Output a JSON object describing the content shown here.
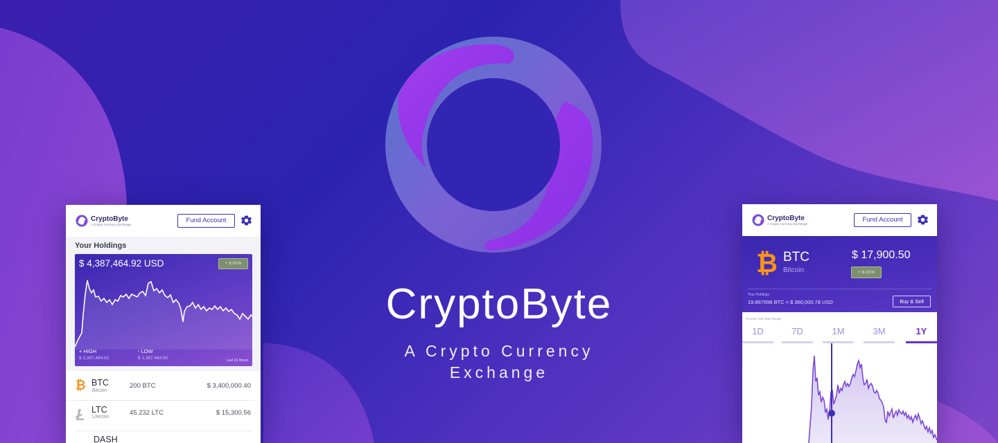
{
  "hero": {
    "title": "CryptoByte",
    "subtitle_line1": "A Crypto Currency",
    "subtitle_line2": "Exchange"
  },
  "colors": {
    "background_start": "#3a1fae",
    "background_end": "#7b45c9",
    "accent": "#3b2fb4",
    "highlight_purple": "#8e2de8",
    "bitcoin_orange": "#f7931a"
  },
  "header": {
    "brand_name": "CryptoByte",
    "brand_tagline": "A Crypto Currency Exchange",
    "fund_button": "Fund Account",
    "settings_icon": "gear-icon"
  },
  "holdings_screen": {
    "section_title": "Your Holdings",
    "total": "$ 4,387,464.92 USD",
    "change_badge": "+ 8.01%",
    "high_label": "+ HIGH",
    "high_value": "$ 3,387,464.92",
    "low_label": "- LOW",
    "low_value": "$ 1,387,464.92",
    "period_label": "Last 24 Hours",
    "coins": [
      {
        "symbol": "BTC",
        "name": "Bitcoin",
        "amount": "200 BTC",
        "value": "$ 3,400,000.40",
        "icon": "bitcoin-icon"
      },
      {
        "symbol": "LTC",
        "name": "Litecoin",
        "amount": "45.232 LTC",
        "value": "$ 15,300.56",
        "icon": "litecoin-icon"
      },
      {
        "symbol": "DASH",
        "name": "",
        "amount": "",
        "value": "",
        "icon": "dash-icon"
      }
    ]
  },
  "coin_screen": {
    "symbol": "BTC",
    "name": "Bitcoin",
    "price": "$ 17,900.50",
    "change_badge": "+ 8.01%",
    "holdings_label": "Your Holdings",
    "holdings_value": "19.867698 BTC = $ 360,000.78 USD",
    "buy_sell_button": "Buy & Sell",
    "range_label": "Choose Your Data Range",
    "ranges": [
      "1D",
      "7D",
      "1M",
      "3M",
      "1Y"
    ],
    "active_range": "1Y"
  }
}
